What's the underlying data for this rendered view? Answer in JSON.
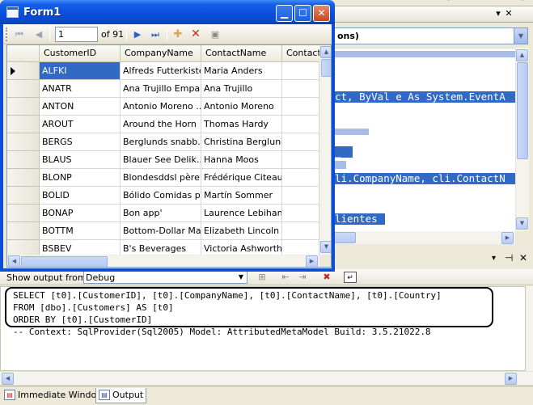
{
  "ide": {
    "combo_text": "ons)",
    "code_lines": [
      "ct, ByVal e As System.EventA",
      "_",
      "li.CompanyName, cli.ContactN",
      "lientes"
    ]
  },
  "output": {
    "show_from_label": "Show output from:",
    "source": "Debug",
    "lines": [
      "SELECT [t0].[CustomerID], [t0].[CompanyName], [t0].[ContactName], [t0].[Country]",
      "FROM [dbo].[Customers] AS [t0]",
      "ORDER BY [t0].[CustomerID]",
      "-- Context: SqlProvider(Sql2005) Model: AttributedMetaModel Build: 3.5.21022.8"
    ]
  },
  "bottom_tabs": [
    {
      "label": "Immediate Window",
      "icon": "immediate-window-icon"
    },
    {
      "label": "Output",
      "icon": "output-icon"
    }
  ],
  "form": {
    "title": "Form1",
    "navigator": {
      "position": "1",
      "count_label": "of 91"
    },
    "grid": {
      "columns": [
        "CustomerID",
        "CompanyName",
        "ContactName",
        "Contact"
      ],
      "rows": [
        [
          "ALFKI",
          "Alfreds Futterkiste",
          "Maria Anders"
        ],
        [
          "ANATR",
          "Ana Trujillo Empa...",
          "Ana Trujillo"
        ],
        [
          "ANTON",
          "Antonio Moreno ...",
          "Antonio Moreno"
        ],
        [
          "AROUT",
          "Around the Horn",
          "Thomas Hardy"
        ],
        [
          "BERGS",
          "Berglunds snabb...",
          "Christina Berglund"
        ],
        [
          "BLAUS",
          "Blauer See Delik...",
          "Hanna Moos"
        ],
        [
          "BLONP",
          "Blondesddsl père...",
          "Frédérique Citeaux"
        ],
        [
          "BOLID",
          "Bólido Comidas p...",
          "Martín Sommer"
        ],
        [
          "BONAP",
          "Bon app'",
          "Laurence Lebihan"
        ],
        [
          "BOTTM",
          "Bottom-Dollar Ma...",
          "Elizabeth Lincoln"
        ],
        [
          "BSBEV",
          "B's Beverages",
          "Victoria Ashworth"
        ]
      ]
    }
  }
}
